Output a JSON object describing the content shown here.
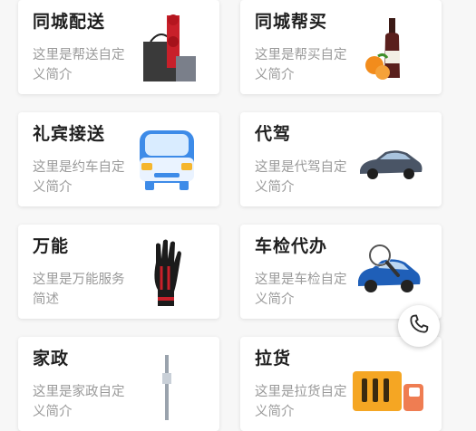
{
  "services": [
    {
      "title": "同城配送",
      "desc": "这里是帮送自定义简介",
      "icon": "delivery-bag-icon"
    },
    {
      "title": "同城帮买",
      "desc": "这里是帮买自定义简介",
      "icon": "wine-fruit-icon"
    },
    {
      "title": "礼宾接送",
      "desc": "这里是约车自定义简介",
      "icon": "car-front-icon"
    },
    {
      "title": "代驾",
      "desc": "这里是代驾自定义简介",
      "icon": "sedan-icon"
    },
    {
      "title": "万能",
      "desc": "这里是万能服务简述",
      "icon": "glove-icon"
    },
    {
      "title": "车检代办",
      "desc": "这里是车检自定义简介",
      "icon": "car-inspection-icon"
    },
    {
      "title": "家政",
      "desc": "这里是家政自定义简介",
      "icon": "mop-icon"
    },
    {
      "title": "拉货",
      "desc": "这里是拉货自定义简介",
      "icon": "truck-icon"
    }
  ],
  "floating": {
    "icon": "phone-icon"
  },
  "colors": {
    "accent": "#f5a623",
    "card": "#ffffff",
    "background": "#f7f7f7"
  }
}
